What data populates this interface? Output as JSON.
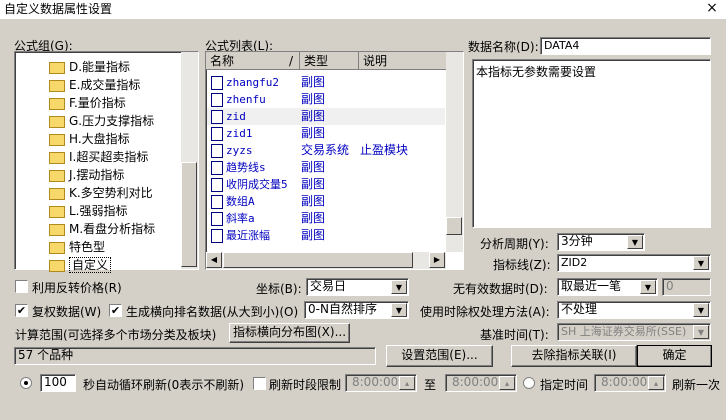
{
  "window": {
    "title": "自定义数据属性设置",
    "close_glyph": "×"
  },
  "formula_group": {
    "label": "公式组(G):",
    "items": [
      "D.能量指标",
      "E.成交量指标",
      "F.量价指标",
      "G.压力支撑指标",
      "H.大盘指标",
      "I.超买超卖指标",
      "J.摆动指标",
      "K.多空势利对比",
      "L.强弱指标",
      "M.看盘分析指标",
      "特色型",
      "自定义"
    ],
    "selected": "自定义"
  },
  "formula_list": {
    "label": "公式列表(L):",
    "columns": [
      "名称",
      "类型",
      "说明"
    ],
    "rows": [
      {
        "name": "zhangfu2",
        "type": "副图",
        "desc": ""
      },
      {
        "name": "zhenfu",
        "type": "副图",
        "desc": ""
      },
      {
        "name": "zid",
        "type": "副图",
        "desc": ""
      },
      {
        "name": "zid1",
        "type": "副图",
        "desc": ""
      },
      {
        "name": "zyzs",
        "type": "交易系统",
        "desc": "止盈模块"
      },
      {
        "name": "趋势线s",
        "type": "副图",
        "desc": ""
      },
      {
        "name": "收阴成交量5",
        "type": "副图",
        "desc": ""
      },
      {
        "name": "数组A",
        "type": "副图",
        "desc": ""
      },
      {
        "name": "斜率a",
        "type": "副图",
        "desc": ""
      },
      {
        "name": "最近涨幅",
        "type": "副图",
        "desc": ""
      }
    ]
  },
  "data_name": {
    "label": "数据名称(D):",
    "value": "DATA4"
  },
  "description_text": "本指标无参数需要设置",
  "period": {
    "label": "分析周期(Y):",
    "value": "3分钟"
  },
  "indicator_line": {
    "label": "指标线(Z):",
    "value": "ZID2"
  },
  "reverse_price": {
    "label": "利用反转价格(R)",
    "checked": false
  },
  "coordinate": {
    "label": "坐标(B):",
    "value": "交易日"
  },
  "invalid_data": {
    "label": "无有效数据时(D):",
    "value": "取最近一笔",
    "number": "0"
  },
  "adjusted": {
    "label": "复权数据(W)",
    "checked": true
  },
  "rank_data": {
    "label": "生成横向排名数据(从大到小)(O)",
    "checked": true,
    "value": "0-N自然排序"
  },
  "ex_rights": {
    "label": "使用时除权处理方法(A):",
    "value": "不处理"
  },
  "calc_range": {
    "label": "计算范围(可选择多个市场分类及板块)",
    "value": "57 个品种"
  },
  "distribution_button": "指标横向分布图(X)...",
  "base_time": {
    "label": "基准时间(T):",
    "value": "SH 上海证券交易所(SSE)"
  },
  "set_range_button": "设置范围(E)...",
  "remove_assoc_button": "去除指标关联(I)",
  "ok_button": "确定",
  "auto_refresh": {
    "seconds": "100",
    "label": "秒自动循环刷新(0表示不刷新)",
    "period_limit_label": "刷新时段限制",
    "from": "8:00:00",
    "to_label": "至",
    "to": "8:00:00",
    "specific_time_label": "指定时间",
    "specific_time": "8:00:00",
    "refresh_once_label": "刷新一次"
  }
}
